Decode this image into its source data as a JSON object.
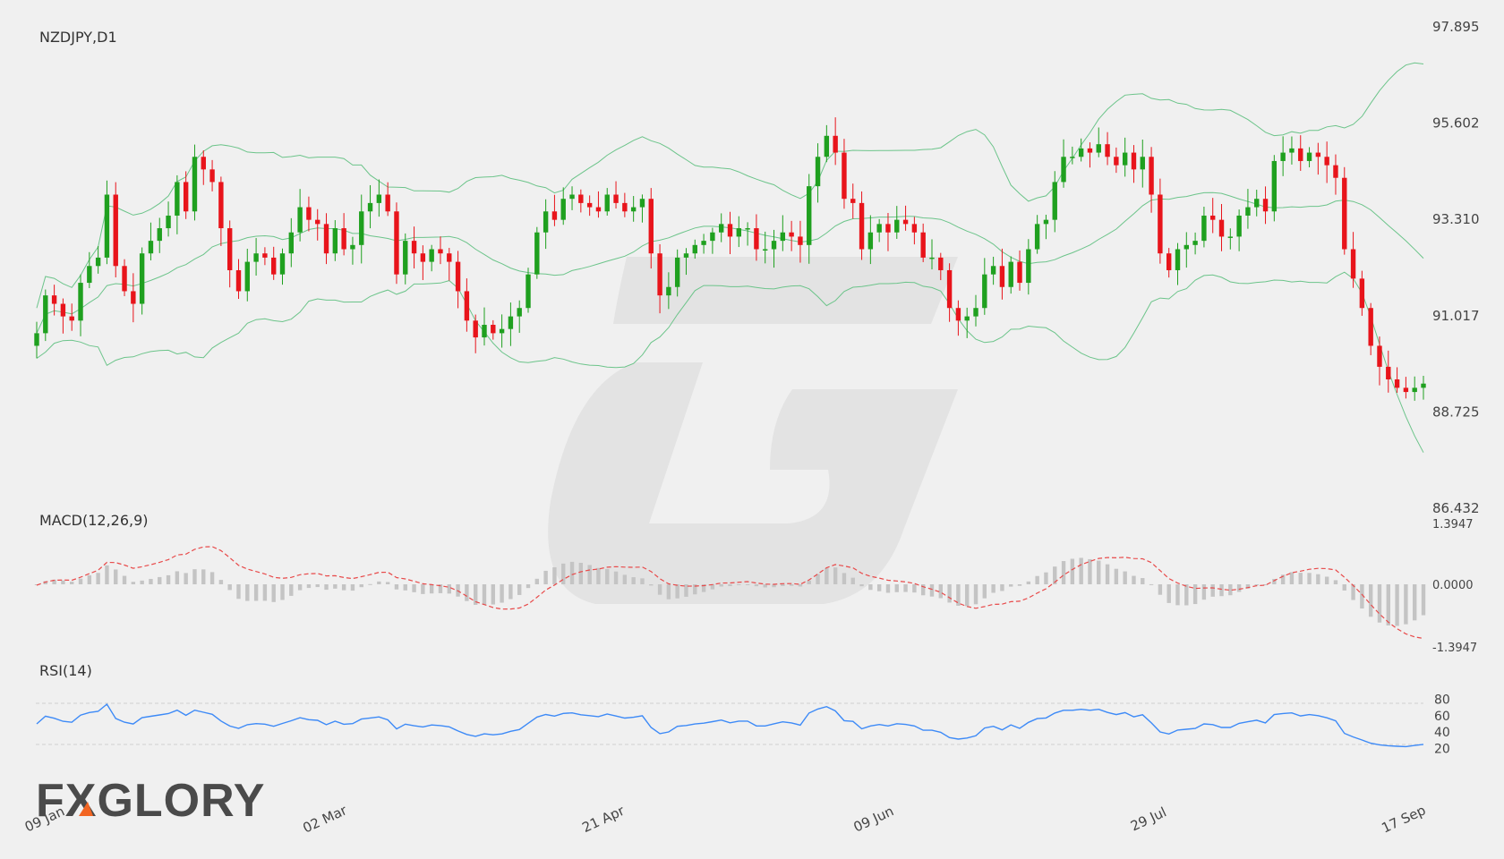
{
  "brand": {
    "logo_text": "FXGLORY"
  },
  "chart_data": [
    {
      "type": "candlestick",
      "title": "NZDJPY,D1",
      "ylim": [
        86.432,
        97.895
      ],
      "y_ticks": [
        "97.895",
        "95.602",
        "93.310",
        "91.017",
        "88.725",
        "86.432"
      ],
      "x_tick_labels": [
        "09 Jan",
        "02 Mar",
        "21 Apr",
        "09 Jun",
        "29 Jul",
        "17 Sep"
      ],
      "colors": {
        "up": "#1fa01f",
        "down": "#e8141b",
        "bands": "#6cc48a"
      },
      "close": [
        90.6,
        91.5,
        91.3,
        91.0,
        90.9,
        91.8,
        92.2,
        92.4,
        93.9,
        92.2,
        91.6,
        91.3,
        92.5,
        92.8,
        93.1,
        93.4,
        94.2,
        93.5,
        94.8,
        94.5,
        94.2,
        93.1,
        92.1,
        91.6,
        92.3,
        92.5,
        92.4,
        92.0,
        92.5,
        93.0,
        93.6,
        93.3,
        93.2,
        92.5,
        93.1,
        92.6,
        92.7,
        93.5,
        93.7,
        93.9,
        93.5,
        92.0,
        92.8,
        92.5,
        92.3,
        92.6,
        92.5,
        92.3,
        91.6,
        90.9,
        90.5,
        90.8,
        90.6,
        90.7,
        91.0,
        91.2,
        92.0,
        93.0,
        93.5,
        93.3,
        93.8,
        93.9,
        93.7,
        93.6,
        93.5,
        93.9,
        93.7,
        93.5,
        93.6,
        93.8,
        92.5,
        91.5,
        91.7,
        92.4,
        92.5,
        92.7,
        92.8,
        93.0,
        93.2,
        92.9,
        93.1,
        93.1,
        92.6,
        92.6,
        92.8,
        93.0,
        92.9,
        92.7,
        94.1,
        94.8,
        95.3,
        94.9,
        93.8,
        93.7,
        92.6,
        93.0,
        93.2,
        93.0,
        93.3,
        93.2,
        93.0,
        92.4,
        92.4,
        92.1,
        91.2,
        90.9,
        91.0,
        91.2,
        92.0,
        92.2,
        91.7,
        92.3,
        91.8,
        92.6,
        93.2,
        93.3,
        94.2,
        94.8,
        94.8,
        95.0,
        94.9,
        95.1,
        94.8,
        94.6,
        94.9,
        94.5,
        94.8,
        93.9,
        92.5,
        92.1,
        92.6,
        92.7,
        92.8,
        93.4,
        93.3,
        92.9,
        92.9,
        93.4,
        93.6,
        93.8,
        93.5,
        94.7,
        94.9,
        95.0,
        94.7,
        94.9,
        94.8,
        94.6,
        94.3,
        92.6,
        91.9,
        91.2,
        90.3,
        89.8,
        89.5,
        89.3,
        89.2,
        89.3,
        89.4
      ]
    },
    {
      "type": "line",
      "title": "MACD(12,26,9)",
      "ylim": [
        -1.3947,
        1.3947
      ],
      "y_ticks": [
        "1.3947",
        "0.0000",
        "-1.3947"
      ],
      "colors": {
        "signal": "#e84a4a",
        "histogram": "#c4c4c4"
      }
    },
    {
      "type": "line",
      "title": "RSI(14)",
      "ylim": [
        0,
        100
      ],
      "y_ticks": [
        "80",
        "60",
        "40",
        "20"
      ],
      "levels": [
        70,
        30
      ],
      "colors": {
        "line": "#3d8af7"
      }
    }
  ]
}
